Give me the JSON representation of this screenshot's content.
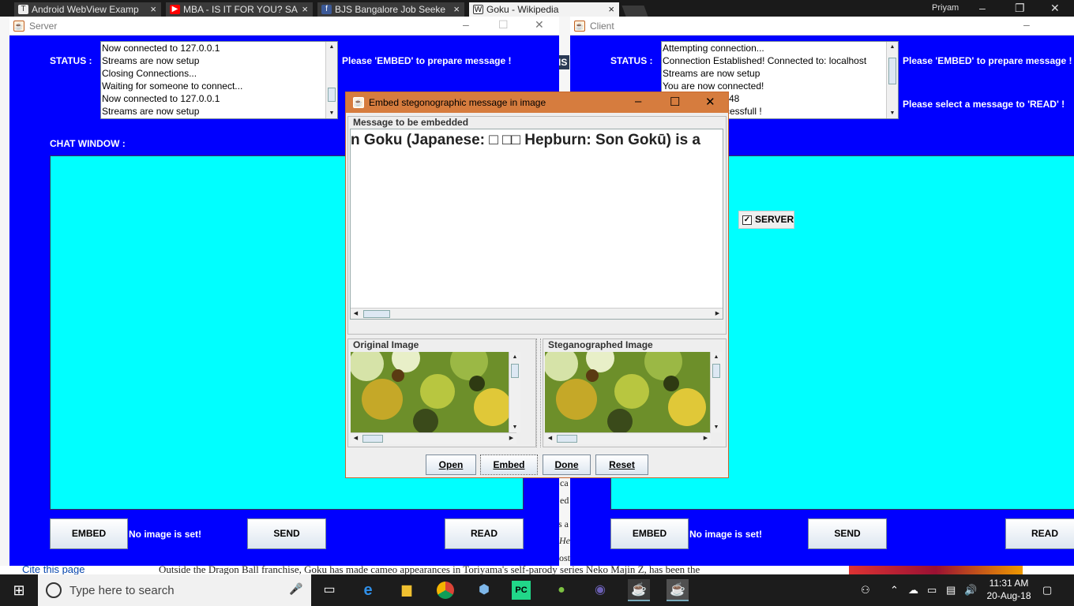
{
  "browser": {
    "tabs": [
      {
        "label": "Android WebView Examp",
        "icon": "tumblr-icon"
      },
      {
        "label": "MBA - IS IT FOR YOU? SA",
        "icon": "youtube-icon"
      },
      {
        "label": "BJS Bangalore Job Seeke",
        "icon": "facebook-icon"
      },
      {
        "label": "Goku - Wikipedia",
        "icon": "wikipedia-icon"
      }
    ],
    "profile": "Priyam"
  },
  "server": {
    "title": "Server",
    "status_label": "STATUS :",
    "status_lines": [
      "Now connected to 127.0.0.1",
      "Streams are now setup",
      "Closing Connections...",
      "Waiting for someone to connect...",
      "Now connected to 127.0.0.1",
      "Streams are now setup"
    ],
    "info_embed": "Please 'EMBED' to prepare message !",
    "chat_label": "CHAT WINDOW :",
    "embed_btn": "EMBED",
    "no_image": "No image is set!",
    "send_btn": "SEND",
    "read_btn": "READ"
  },
  "client": {
    "title": "Client",
    "status_label": "STATUS :",
    "status_lines": [
      "Attempting connection...",
      "Connection Established! Connected to: localhost",
      "Streams are now setup",
      " You are now connected!",
      "48",
      "cessfull !"
    ],
    "info_embed": "Please 'EMBED' to prepare message !",
    "info_read": "Please select a message to 'READ' !",
    "checkbox_label": "SERVER",
    "embed_btn": "EMBED",
    "no_image": "No image is set!",
    "send_btn": "SEND",
    "read_btn": "READ"
  },
  "dialog": {
    "title": "Embed stegonographic message in image",
    "message_group": "Message to be embedded",
    "message_text": "n Goku (Japanese: □ □□ Hepburn: Son Gokū) is a",
    "original_group": "Original Image",
    "stego_group": "Steganographed Image",
    "buttons": {
      "open": "Open",
      "embed": "Embed",
      "done": "Done",
      "reset": "Reset"
    }
  },
  "wiki": {
    "cite": "Cite this page",
    "bottom_line": "Outside the Dragon Ball franchise, Goku has made cameo appearances in Toriyama's self-parody series Neko Majin Z, has been the",
    "fragments": [
      "ca",
      "ed",
      "s a",
      "He",
      "ost",
      "IS"
    ]
  },
  "taskbar": {
    "search_placeholder": "Type here to search",
    "time": "11:31 AM",
    "date": "20-Aug-18"
  }
}
